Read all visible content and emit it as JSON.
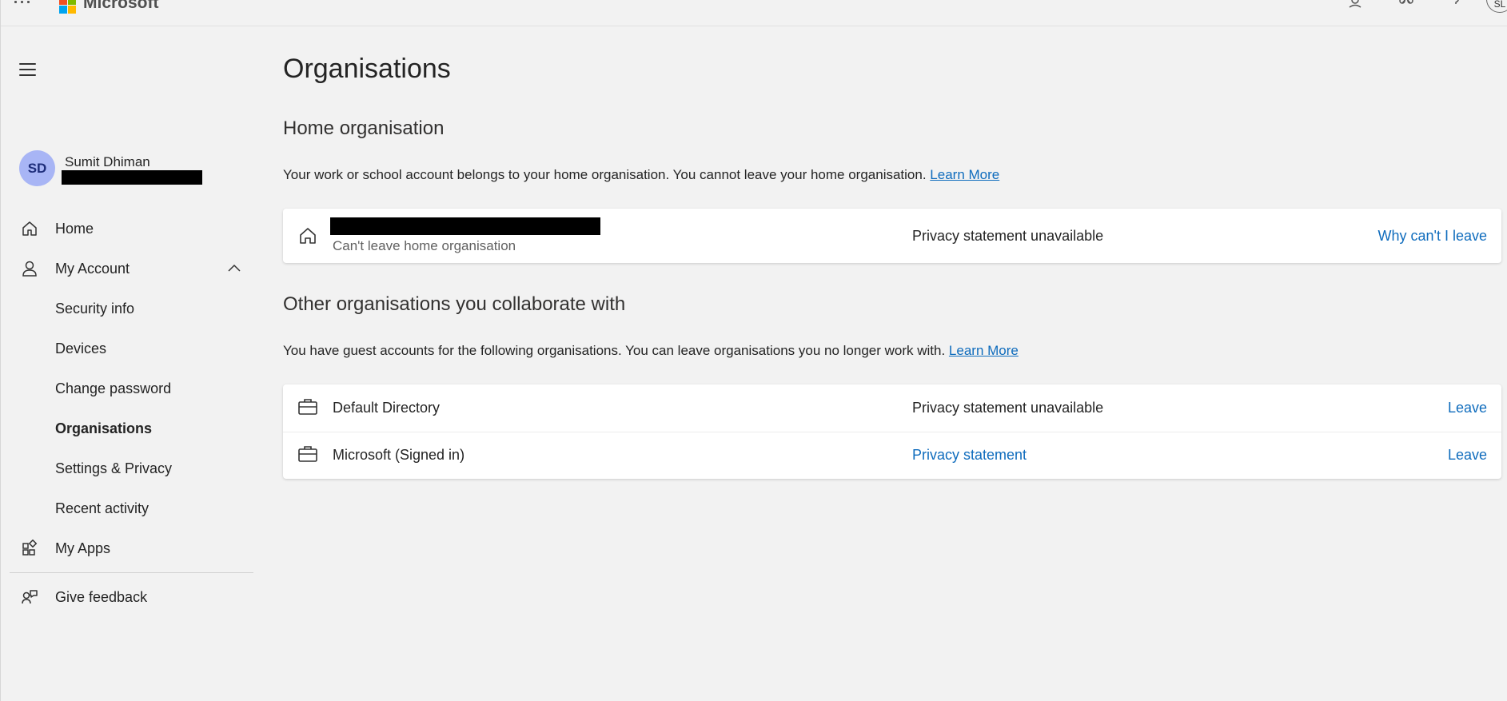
{
  "header": {
    "brand": "Microsoft",
    "user_initials": "SL",
    "icons": [
      "app-launcher-icon",
      "microsoft-logo-icon",
      "user-help-icon",
      "organization-icon",
      "help-icon"
    ]
  },
  "sidebar": {
    "user": {
      "initials": "SD",
      "name": "Sumit Dhiman"
    },
    "items": [
      {
        "label": "Home",
        "icon": "home-icon"
      },
      {
        "label": "My Account",
        "icon": "person-icon",
        "expanded": true
      },
      {
        "label": "Security info"
      },
      {
        "label": "Devices"
      },
      {
        "label": "Change password"
      },
      {
        "label": "Organisations",
        "active": true
      },
      {
        "label": "Settings & Privacy"
      },
      {
        "label": "Recent activity"
      },
      {
        "label": "My Apps",
        "icon": "apps-icon"
      },
      {
        "label": "Give feedback",
        "icon": "feedback-icon"
      }
    ]
  },
  "main": {
    "title": "Organisations",
    "home_section": {
      "heading": "Home organisation",
      "description": "Your work or school account belongs to your home organisation. You cannot leave your home organisation.",
      "learn_more": "Learn More",
      "org": {
        "subtitle": "Can't leave home organisation",
        "privacy": "Privacy statement unavailable",
        "action": "Why can't I leave"
      }
    },
    "other_section": {
      "heading": "Other organisations you collaborate with",
      "description": "You have guest accounts for the following organisations. You can leave organisations you no longer work with.",
      "learn_more": "Learn More",
      "orgs": [
        {
          "name": "Default Directory",
          "privacy": "Privacy statement unavailable",
          "privacy_is_link": false,
          "action": "Leave"
        },
        {
          "name": "Microsoft (Signed in)",
          "privacy": "Privacy statement",
          "privacy_is_link": true,
          "action": "Leave"
        }
      ]
    }
  },
  "colors": {
    "accent": "#0f6cbd",
    "background": "#f2f2f2",
    "avatar": "#a8b5f5"
  }
}
